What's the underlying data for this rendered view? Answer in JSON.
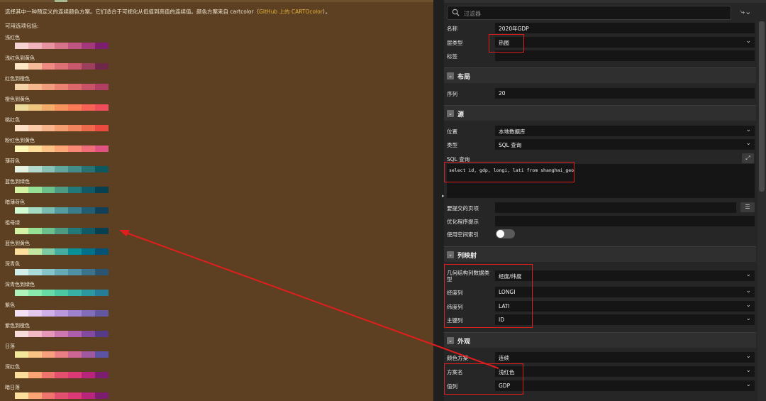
{
  "help": {
    "intro_text": "选择其中一种预定义的连续颜色方案。它们适合于可视化从低值到高值的连续值。颜色方案来自 cartcolor（",
    "intro_link": "GitHub 上的 CARTOcolor",
    "intro_end": "）。",
    "available_label": "可用选项包括:",
    "schemes": [
      {
        "name": "浅红色",
        "colors": [
          "#f6d2d5",
          "#f0b3bd",
          "#e6929f",
          "#d6728a",
          "#c05483",
          "#a3387d",
          "#7c1d6f"
        ]
      },
      {
        "name": "浅红色到黄色",
        "colors": [
          "#fbe6c5",
          "#f5ba98",
          "#ee8a82",
          "#dc7176",
          "#c8586c",
          "#9c3f5d",
          "#70284a"
        ]
      },
      {
        "name": "红色到橙色",
        "colors": [
          "#f6d2a9",
          "#f5b78e",
          "#f19c7c",
          "#ea8171",
          "#dd686c",
          "#ca5268",
          "#b13f64"
        ]
      },
      {
        "name": "橙色到黄色",
        "colors": [
          "#ecda9a",
          "#efc47e",
          "#f3ad6a",
          "#f7945d",
          "#f97b57",
          "#f66356",
          "#ee4d5a"
        ]
      },
      {
        "name": "桃红色",
        "colors": [
          "#fde0c5",
          "#facba6",
          "#f8b58b",
          "#f59e72",
          "#f2855d",
          "#ef6a4c",
          "#eb4a40"
        ]
      },
      {
        "name": "粉红色到黄色",
        "colors": [
          "#fef6b5",
          "#ffdd9a",
          "#ffc285",
          "#ffa679",
          "#fa8a76",
          "#f16d7a",
          "#e15383"
        ]
      },
      {
        "name": "薄荷色",
        "colors": [
          "#e4f1e1",
          "#b4d9cc",
          "#89c0b6",
          "#63a6a0",
          "#448c8a",
          "#287274",
          "#0d585f"
        ]
      },
      {
        "name": "蓝色到绿色",
        "colors": [
          "#d3f2a3",
          "#97e196",
          "#6cc08b",
          "#4c9b82",
          "#217a79",
          "#105965",
          "#074050"
        ]
      },
      {
        "name": "暗薄荷色",
        "colors": [
          "#d2fbd4",
          "#a5dbc2",
          "#7bbcb0",
          "#559c9e",
          "#3a7c89",
          "#235d72",
          "#123f5a"
        ]
      },
      {
        "name": "祖母绿",
        "colors": [
          "#d3f2a3",
          "#97e196",
          "#6cc08b",
          "#4c9b82",
          "#217a79",
          "#105965",
          "#074050"
        ]
      },
      {
        "name": "蓝色到黄色",
        "colors": [
          "#fcde9c",
          "#c4e6a0",
          "#7ccba2",
          "#46aea0",
          "#089099",
          "#00718b",
          "#045275"
        ]
      },
      {
        "name": "深青色",
        "colors": [
          "#d1eeea",
          "#a8dbd9",
          "#85c4c9",
          "#68abb8",
          "#4f90a6",
          "#3b738f",
          "#2a5674"
        ]
      },
      {
        "name": "深青色到绿色",
        "colors": [
          "#b0f2bc",
          "#89e8ac",
          "#67dba5",
          "#4cc8a3",
          "#38b2a3",
          "#2c98a0",
          "#257d98"
        ]
      },
      {
        "name": "紫色",
        "colors": [
          "#f3e0f7",
          "#e4c7f1",
          "#d1afe8",
          "#b998dd",
          "#9f82ce",
          "#826dba",
          "#63589f"
        ]
      },
      {
        "name": "紫色到橙色",
        "colors": [
          "#f9ddda",
          "#f2b9c4",
          "#e597b9",
          "#ce78b3",
          "#ad5fad",
          "#834ba0",
          "#573b88"
        ]
      },
      {
        "name": "日落",
        "colors": [
          "#f3e79b",
          "#fac484",
          "#f8a07e",
          "#eb7f86",
          "#ce6693",
          "#a059a0",
          "#5c53a5"
        ]
      },
      {
        "name": "深红色",
        "colors": [
          "#fcde9c",
          "#faa476",
          "#f0746e",
          "#e34f6f",
          "#dc3977",
          "#b9257a",
          "#7c1d6f"
        ]
      },
      {
        "name": "暗日落",
        "colors": [
          "#fcde9c",
          "#faa476",
          "#f0746e",
          "#e34f6f",
          "#dc3977",
          "#b9257a",
          "#7c1d6f"
        ]
      }
    ]
  },
  "props": {
    "filter_placeholder": "过滤器",
    "name_label": "名称",
    "name_value": "2020年GDP",
    "layer_type_label": "层类型",
    "layer_type_value": "热图",
    "tag_label": "标签",
    "tag_value": "",
    "layout_title": "布局",
    "sequence_label": "序列",
    "sequence_value": "20",
    "source_title": "源",
    "location_label": "位置",
    "location_value": "本地数据库",
    "type_label": "类型",
    "type_value": "SQL 查询",
    "sql_label": "SQL 查询",
    "sql_value": "select id, gdp, longi, lati from shanghai_geo",
    "submit_label": "要提交的页项",
    "submit_value": "",
    "optimizer_label": "优化程序提示",
    "optimizer_value": "",
    "spatial_label": "使用空间索引",
    "colmap_title": "列映射",
    "geom_type_label": "几何结构列数据类型",
    "geom_type_value": "经度/纬度",
    "lon_label": "经度列",
    "lon_value": "LONGI",
    "lat_label": "纬度列",
    "lat_value": "LATI",
    "pk_label": "主键列",
    "pk_value": "ID",
    "appearance_title": "外观",
    "color_scheme_type_label": "颜色方案",
    "color_scheme_type_value": "连续",
    "scheme_name_label": "方案名",
    "scheme_name_value": "浅红色",
    "value_col_label": "值列",
    "value_col_value": "GDP"
  },
  "annotation_color": "#e01e1e"
}
